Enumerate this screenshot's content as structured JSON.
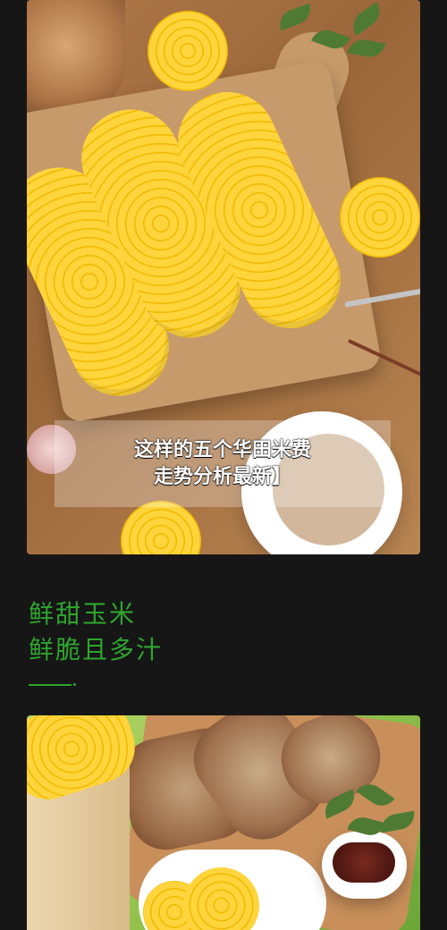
{
  "overlay": {
    "line1": "这样的五个华田米费",
    "line2": "走势分析最新】"
  },
  "section": {
    "headline_line1": "鲜甜玉米",
    "headline_line2": "鲜脆且多汁"
  },
  "images": {
    "top_photo": "corn-on-cutting-board-photo",
    "bottom_photo": "bread-and-corn-photo"
  },
  "colors": {
    "page_background": "#161616",
    "accent_green": "#2ea52e",
    "overlay_background": "rgba(255,255,255,0.28)"
  }
}
